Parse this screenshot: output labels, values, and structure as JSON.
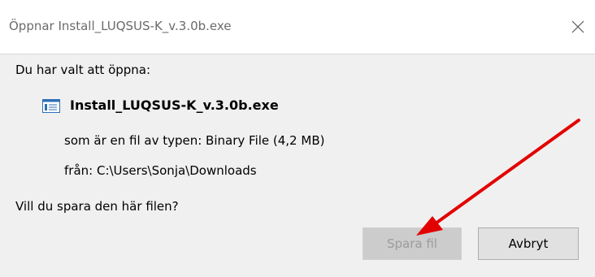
{
  "window": {
    "title": "Öppnar Install_LUQSUS-K_v.3.0b.exe"
  },
  "dialog": {
    "intro": "Du har valt att öppna:",
    "file_name": "Install_LUQSUS-K_v.3.0b.exe",
    "file_type_line": "som är en fil av typen:  Binary File (4,2 MB)",
    "source_line": "från:  C:\\Users\\Sonja\\Downloads",
    "question": "Vill du spara den här filen?"
  },
  "buttons": {
    "save_label": "Spara fil",
    "cancel_label": "Avbryt"
  },
  "icons": {
    "close": "close-icon",
    "file": "executable-file-icon"
  },
  "colors": {
    "annotation_arrow": "#e30000",
    "dialog_background": "#f0f0f0",
    "disabled_text": "#9b9b9b"
  },
  "annotation": {
    "type": "red-arrow",
    "points_to": "save-file-button"
  }
}
